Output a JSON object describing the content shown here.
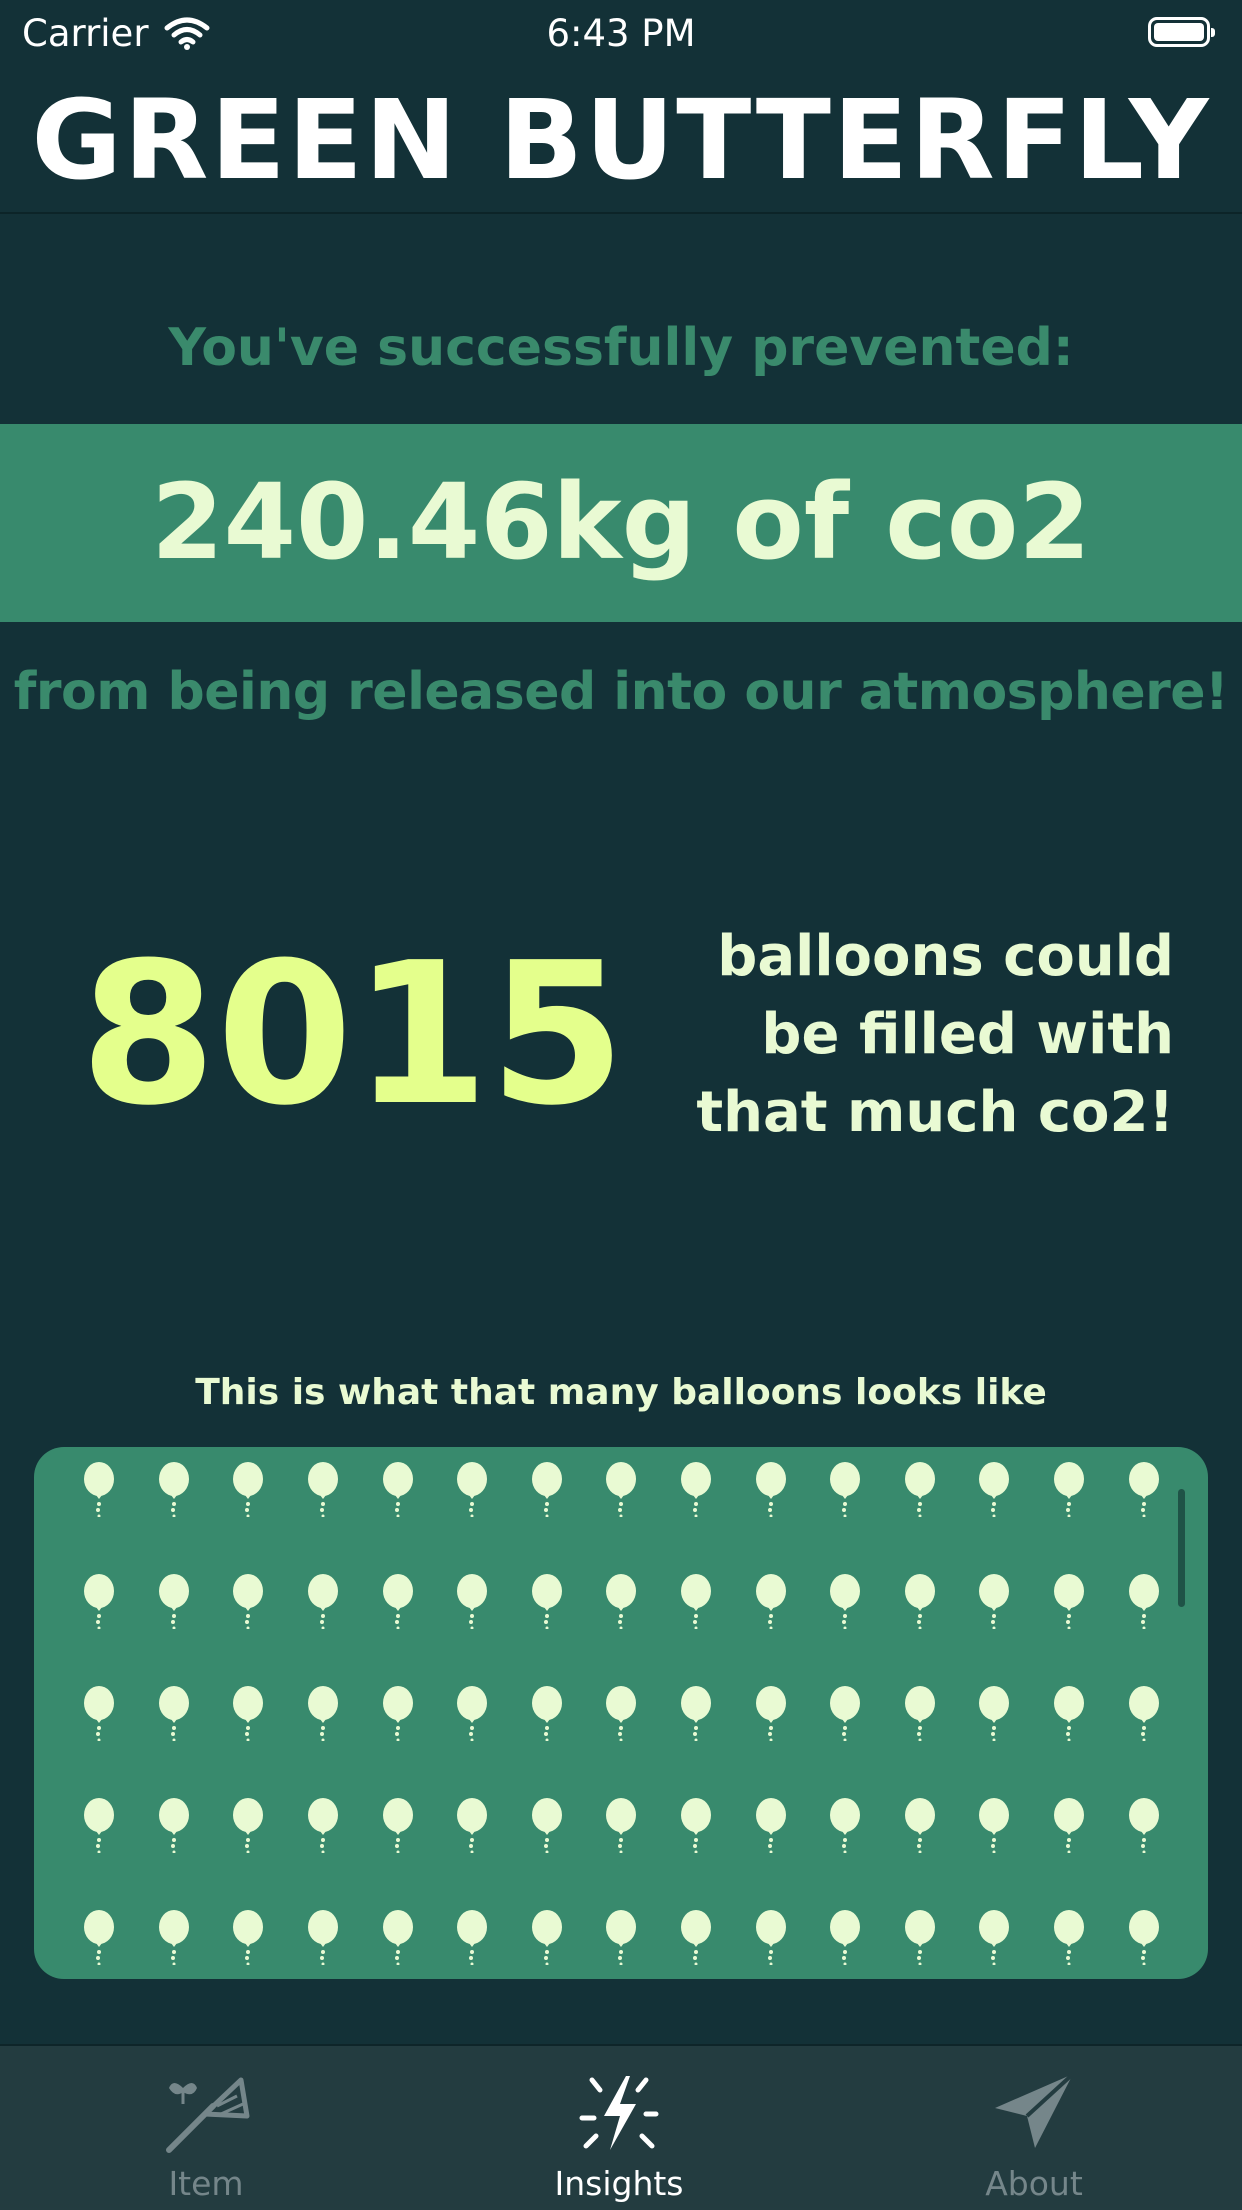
{
  "status_bar": {
    "carrier": "Carrier",
    "time": "6:43 PM"
  },
  "header": {
    "title": "GREEN BUTTERFLY"
  },
  "summary": {
    "intro": "You've successfully prevented:",
    "co2_amount": "240.46kg of co2",
    "outro": "from being released into our atmosphere!"
  },
  "balloons": {
    "count": "8015",
    "caption_lines": [
      "balloons could",
      "be filled with",
      "that much co2!"
    ],
    "grid_title": "This is what that many balloons looks like"
  },
  "tabs": [
    {
      "label": "Item",
      "icon": "butterfly-net-icon",
      "active": false
    },
    {
      "label": "Insights",
      "icon": "sparkle-bolt-icon",
      "active": true
    },
    {
      "label": "About",
      "icon": "paper-plane-icon",
      "active": false
    }
  ],
  "colors": {
    "background": "#133137",
    "accent_band": "#388a6d",
    "muted_text": "#3a8a6c",
    "highlight_number": "#e4ff8c",
    "light_text": "#e9fad3",
    "tab_bar": "#233c40"
  }
}
